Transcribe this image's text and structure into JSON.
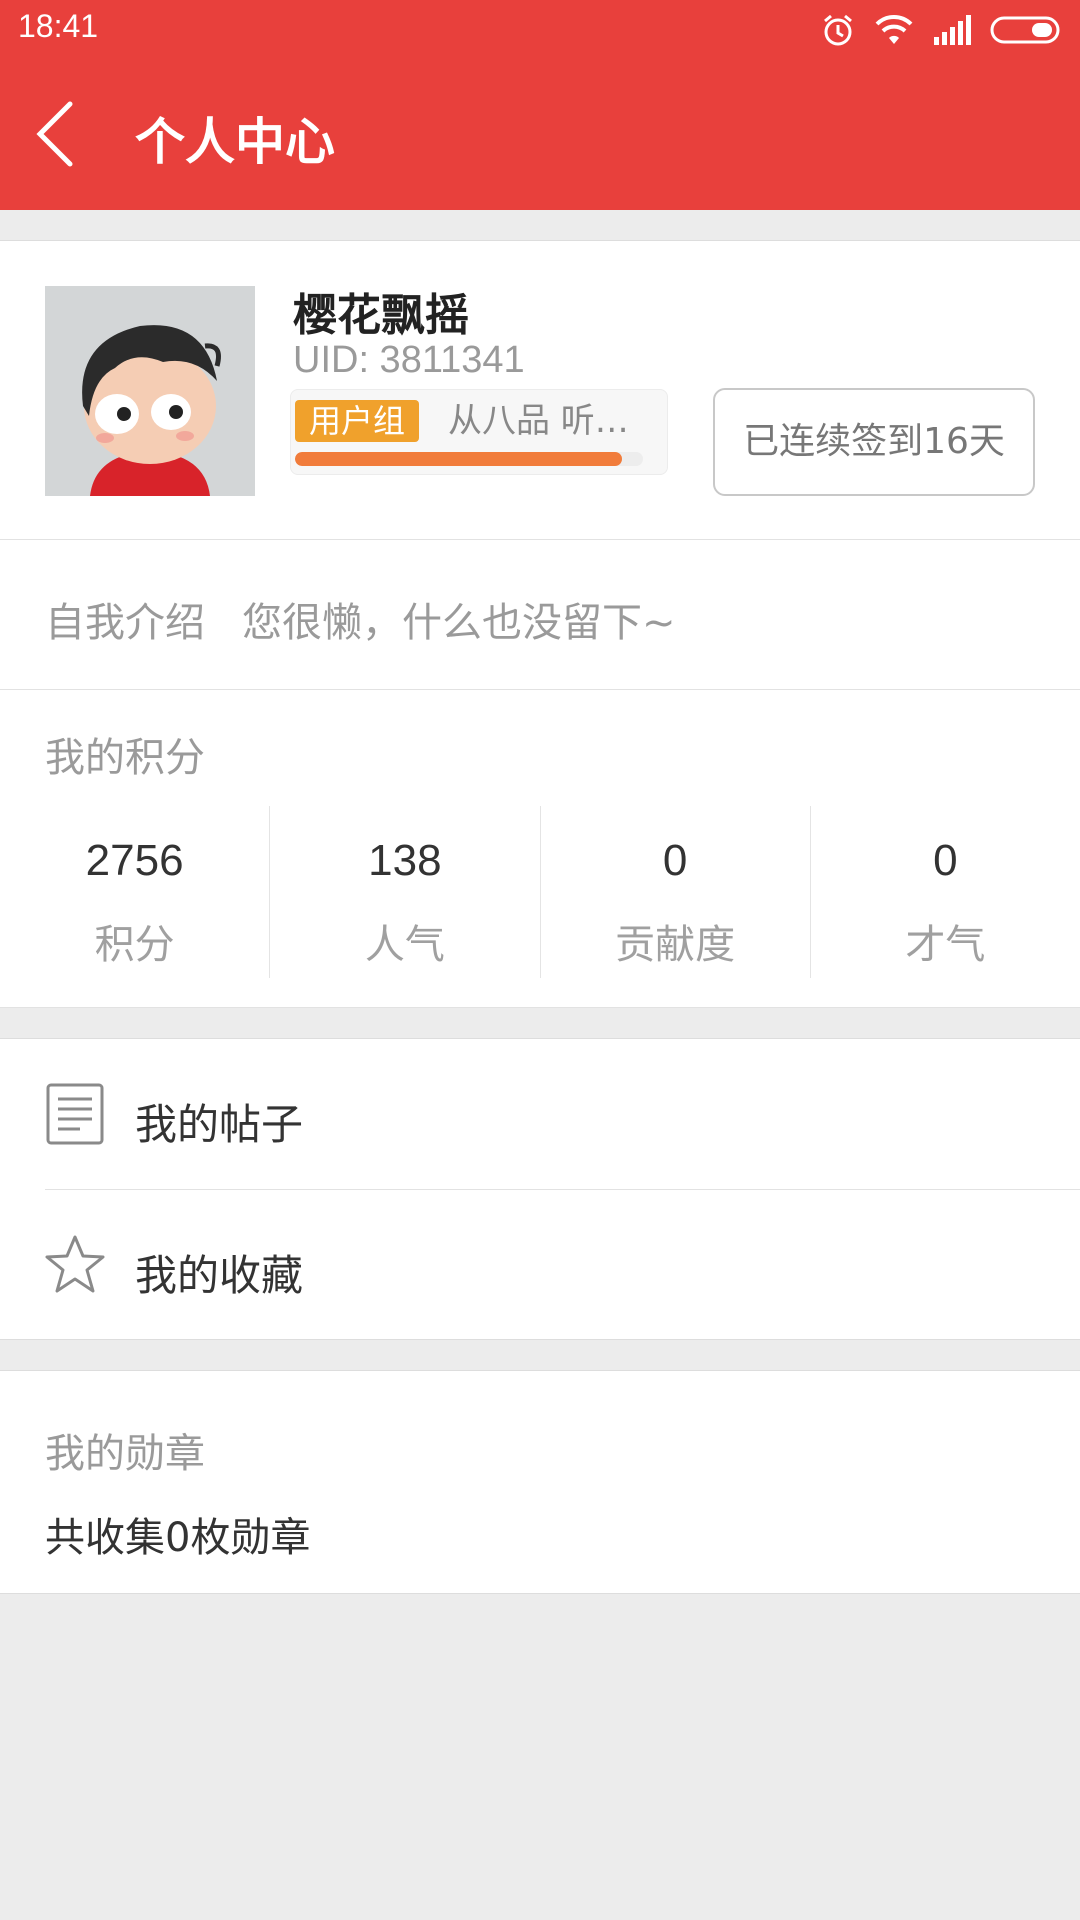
{
  "status_bar": {
    "time": "18:41",
    "icons": [
      "alarm-icon",
      "wifi-icon",
      "signal-icon",
      "battery-icon"
    ]
  },
  "header": {
    "title": "个人中心",
    "back_icon": "chevron-left-icon",
    "background_color": "#e8403c"
  },
  "profile": {
    "username": "樱花飘摇",
    "uid": "UID: 3811341",
    "group_tag": "用户组",
    "group_name": "从八品  听…",
    "level_progress": 0.94,
    "checkin_label": "已连续签到16天"
  },
  "intro": {
    "label": "自我介绍",
    "text": "您很懒，什么也没留下~"
  },
  "points": {
    "title": "我的积分",
    "stats": [
      {
        "value": "2756",
        "label": "积分"
      },
      {
        "value": "138",
        "label": "人气"
      },
      {
        "value": "0",
        "label": "贡献度"
      },
      {
        "value": "0",
        "label": "才气"
      }
    ]
  },
  "menu": {
    "items": [
      {
        "label": "我的帖子",
        "icon": "document-icon"
      },
      {
        "label": "我的收藏",
        "icon": "star-icon"
      }
    ]
  },
  "medals": {
    "title": "我的勋章",
    "text": "共收集0枚勋章"
  },
  "colors": {
    "accent": "#e8403c",
    "tag": "#f0a12c",
    "progress": "#f17c3b"
  }
}
